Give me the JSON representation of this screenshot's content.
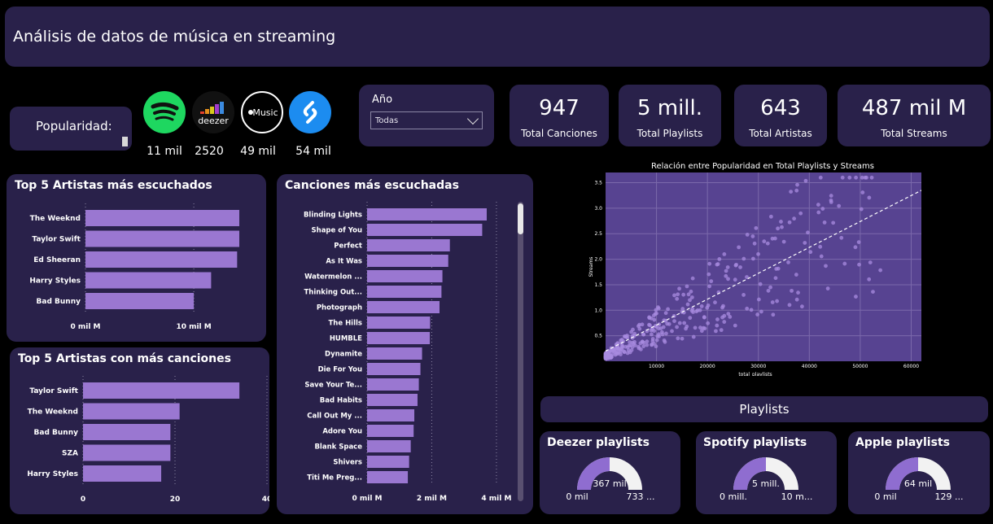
{
  "header": {
    "title": "Análisis de datos de música en streaming"
  },
  "popularity": {
    "label": "Popularidad:",
    "platforms": [
      {
        "icon": "spotify-icon",
        "value": "11 mil"
      },
      {
        "icon": "deezer-icon",
        "name": "deezer",
        "value": "2520"
      },
      {
        "icon": "apple-music-icon",
        "name": "Music",
        "value": "49 mil"
      },
      {
        "icon": "shazam-icon",
        "value": "54 mil"
      }
    ]
  },
  "filter": {
    "label": "Año",
    "selected": "Todas"
  },
  "kpis": [
    {
      "value": "947",
      "label": "Total Canciones"
    },
    {
      "value": "5 mill.",
      "label": "Total Playlists"
    },
    {
      "value": "643",
      "label": "Total Artistas"
    },
    {
      "value": "487 mil M",
      "label": "Total Streams"
    }
  ],
  "playlists_header": "Playlists",
  "colors": {
    "bar": "#9a77d1",
    "panel": "#29214a",
    "scatter_bg": "#574391",
    "point": "#a88be0",
    "gauge_fill": "#8f6dd0",
    "gauge_track": "#f2f2f2"
  },
  "chart_data": [
    {
      "id": "top-artists-streams",
      "type": "bar",
      "title": "Top 5 Artistas más escuchados",
      "orientation": "horizontal",
      "categories": [
        "The Weeknd",
        "Taylor Swift",
        "Ed Sheeran",
        "Harry Styles",
        "Bad Bunny"
      ],
      "values": [
        14.2,
        14.2,
        14.0,
        11.6,
        10.0
      ],
      "xticks": [
        "0 mil M",
        "10 mil M"
      ],
      "xlim": [
        0,
        15
      ],
      "grid": true
    },
    {
      "id": "top-artists-songs",
      "type": "bar",
      "title": "Top 5 Artistas con más canciones",
      "orientation": "horizontal",
      "categories": [
        "Taylor Swift",
        "The Weeknd",
        "Bad Bunny",
        "SZA",
        "Harry Styles"
      ],
      "values": [
        34,
        21,
        19,
        19,
        17
      ],
      "xticks": [
        "0",
        "20",
        "40"
      ],
      "xlim": [
        0,
        40
      ],
      "grid": true
    },
    {
      "id": "top-songs",
      "type": "bar",
      "title": "Canciones más escuchadas",
      "orientation": "horizontal",
      "categories": [
        "Blinding Lights",
        "Shape of You",
        "Perfect",
        "As It Was",
        "Watermelon ...",
        "Thinking Out...",
        "Photograph",
        "The Hills",
        "HUMBLE",
        "Dynamite",
        "Die For You",
        "Save Your Te...",
        "Bad Habits",
        "Call Out My ...",
        "Adore You",
        "Blank Space",
        "Shivers",
        "Titi Me Preg..."
      ],
      "values": [
        3.7,
        3.56,
        2.56,
        2.51,
        2.33,
        2.3,
        2.24,
        1.95,
        1.94,
        1.7,
        1.65,
        1.6,
        1.56,
        1.46,
        1.44,
        1.35,
        1.3,
        1.26
      ],
      "xticks": [
        "0 mil M",
        "2 mil M",
        "4 mil M"
      ],
      "xlim": [
        0,
        4.4
      ],
      "grid": true
    },
    {
      "id": "scatter",
      "type": "scatter",
      "title": "Relación entre Popularidad en Total Playlists y Streams",
      "xlabel": "total_playlists",
      "ylabel": "Streams",
      "xlim": [
        0,
        62000
      ],
      "ylim": [
        0,
        3.7
      ],
      "xticks": [
        "10000",
        "20000",
        "30000",
        "40000",
        "50000",
        "60000"
      ],
      "yticks": [
        "0.5",
        "1.0",
        "1.5",
        "2.0",
        "2.5",
        "3.0",
        "3.5"
      ],
      "trend": {
        "x0": 0,
        "y0": 0.2,
        "x1": 62000,
        "y1": 3.35
      },
      "grid": true
    },
    {
      "id": "gauge-deezer",
      "type": "gauge",
      "title": "Deezer playlists",
      "value": 367,
      "min_label": "0 mil",
      "max_label": "733 ...",
      "value_label": "367 mil",
      "fraction": 0.5
    },
    {
      "id": "gauge-spotify",
      "type": "gauge",
      "title": "Spotify playlists",
      "value": 5,
      "min_label": "0 mill.",
      "max_label": "10 m...",
      "value_label": "5 mill.",
      "fraction": 0.5
    },
    {
      "id": "gauge-apple",
      "type": "gauge",
      "title": "Apple playlists",
      "value": 64,
      "min_label": "0 mil",
      "max_label": "129 ...",
      "value_label": "64 mil",
      "fraction": 0.5
    }
  ]
}
